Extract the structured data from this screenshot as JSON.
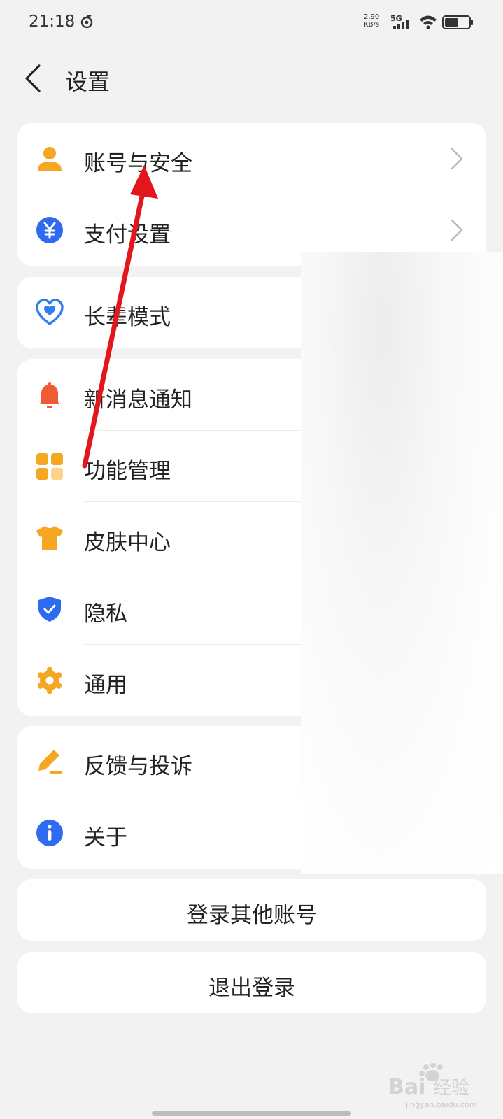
{
  "status_bar": {
    "time": "21:18",
    "net_speed_value": "2.90",
    "net_speed_unit": "KB/s",
    "network_type": "5G"
  },
  "header": {
    "title": "设置",
    "back_icon": "chevron-left-icon"
  },
  "settings_groups": [
    {
      "items": [
        {
          "label": "账号与安全",
          "icon": "person-icon",
          "icon_color": "#f5a623"
        },
        {
          "label": "支付设置",
          "icon": "yuan-icon",
          "icon_color": "#2f6bf0"
        }
      ]
    },
    {
      "items": [
        {
          "label": "长辈模式",
          "icon": "heart-icon",
          "icon_color": "#2f80ed"
        }
      ]
    },
    {
      "items": [
        {
          "label": "新消息通知",
          "icon": "bell-icon",
          "icon_color": "#f05a35"
        },
        {
          "label": "功能管理",
          "icon": "grid-icon",
          "icon_color": "#f5a623"
        },
        {
          "label": "皮肤中心",
          "icon": "tshirt-icon",
          "icon_color": "#f5a623"
        },
        {
          "label": "隐私",
          "icon": "shield-icon",
          "icon_color": "#2f6bf0"
        },
        {
          "label": "通用",
          "icon": "gear-icon",
          "icon_color": "#f5a623"
        }
      ]
    },
    {
      "items": [
        {
          "label": "反馈与投诉",
          "icon": "pencil-icon",
          "icon_color": "#f5a623"
        },
        {
          "label": "关于",
          "icon": "info-icon",
          "icon_color": "#2f6bf0"
        }
      ]
    }
  ],
  "buttons": {
    "switch_account": "登录其他账号",
    "logout": "退出登录"
  },
  "watermark": {
    "brand": "Bai",
    "brand_suffix": "经验",
    "url": "jingyan.baidu.com"
  },
  "colors": {
    "background": "#f2f2f2",
    "card": "#ffffff",
    "annotation_arrow": "#e4161d"
  }
}
